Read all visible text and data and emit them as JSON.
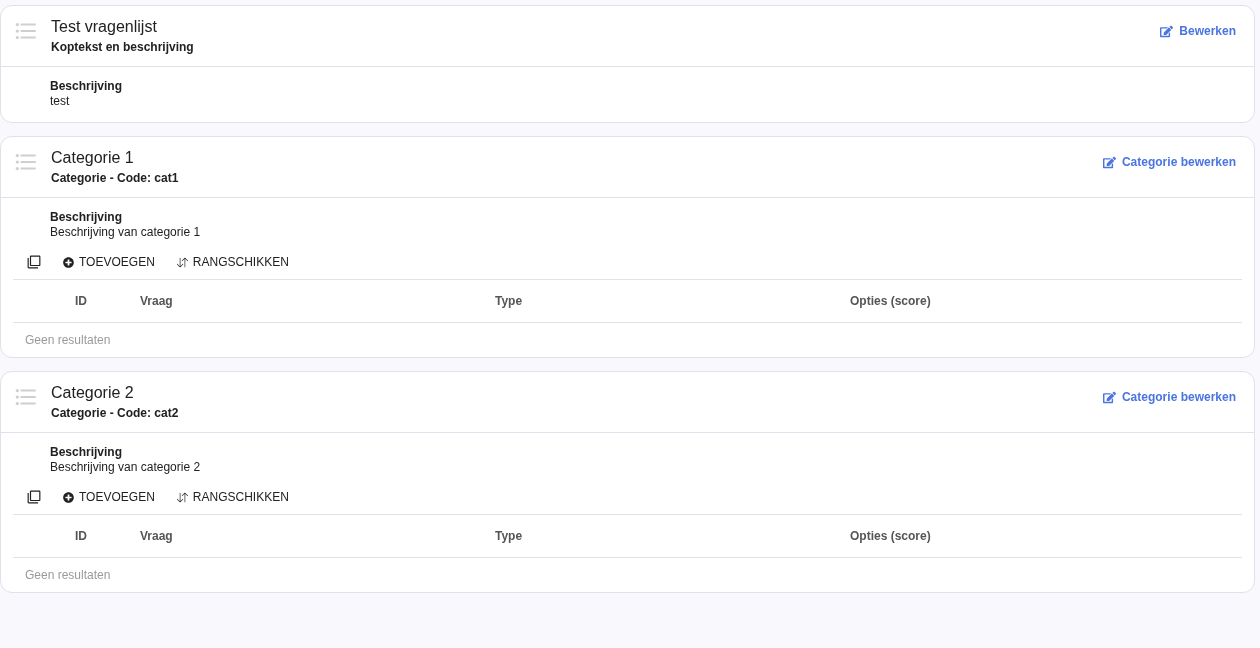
{
  "sections": [
    {
      "kind": "header",
      "title": "Test vragenlijst",
      "subtitle": "Koptekst en beschrijving",
      "edit_label": "Bewerken",
      "description_label": "Beschrijving",
      "description": "test"
    },
    {
      "kind": "category",
      "title": "Categorie 1",
      "subtitle": "Categorie - Code: cat1",
      "edit_label": "Categorie bewerken",
      "description_label": "Beschrijving",
      "description": "Beschrijving van categorie 1",
      "toolbar": [
        "TOEVOEGEN",
        "RANGSCHIKKEN"
      ],
      "columns": [
        "ID",
        "Vraag",
        "Type",
        "Opties (score)"
      ],
      "empty_text": "Geen resultaten"
    },
    {
      "kind": "category",
      "title": "Categorie 2",
      "subtitle": "Categorie - Code: cat2",
      "edit_label": "Categorie bewerken",
      "description_label": "Beschrijving",
      "description": "Beschrijving van categorie 2",
      "toolbar": [
        "TOEVOEGEN",
        "RANGSCHIKKEN"
      ],
      "columns": [
        "ID",
        "Vraag",
        "Type",
        "Opties (score)"
      ],
      "empty_text": "Geen resultaten"
    }
  ]
}
